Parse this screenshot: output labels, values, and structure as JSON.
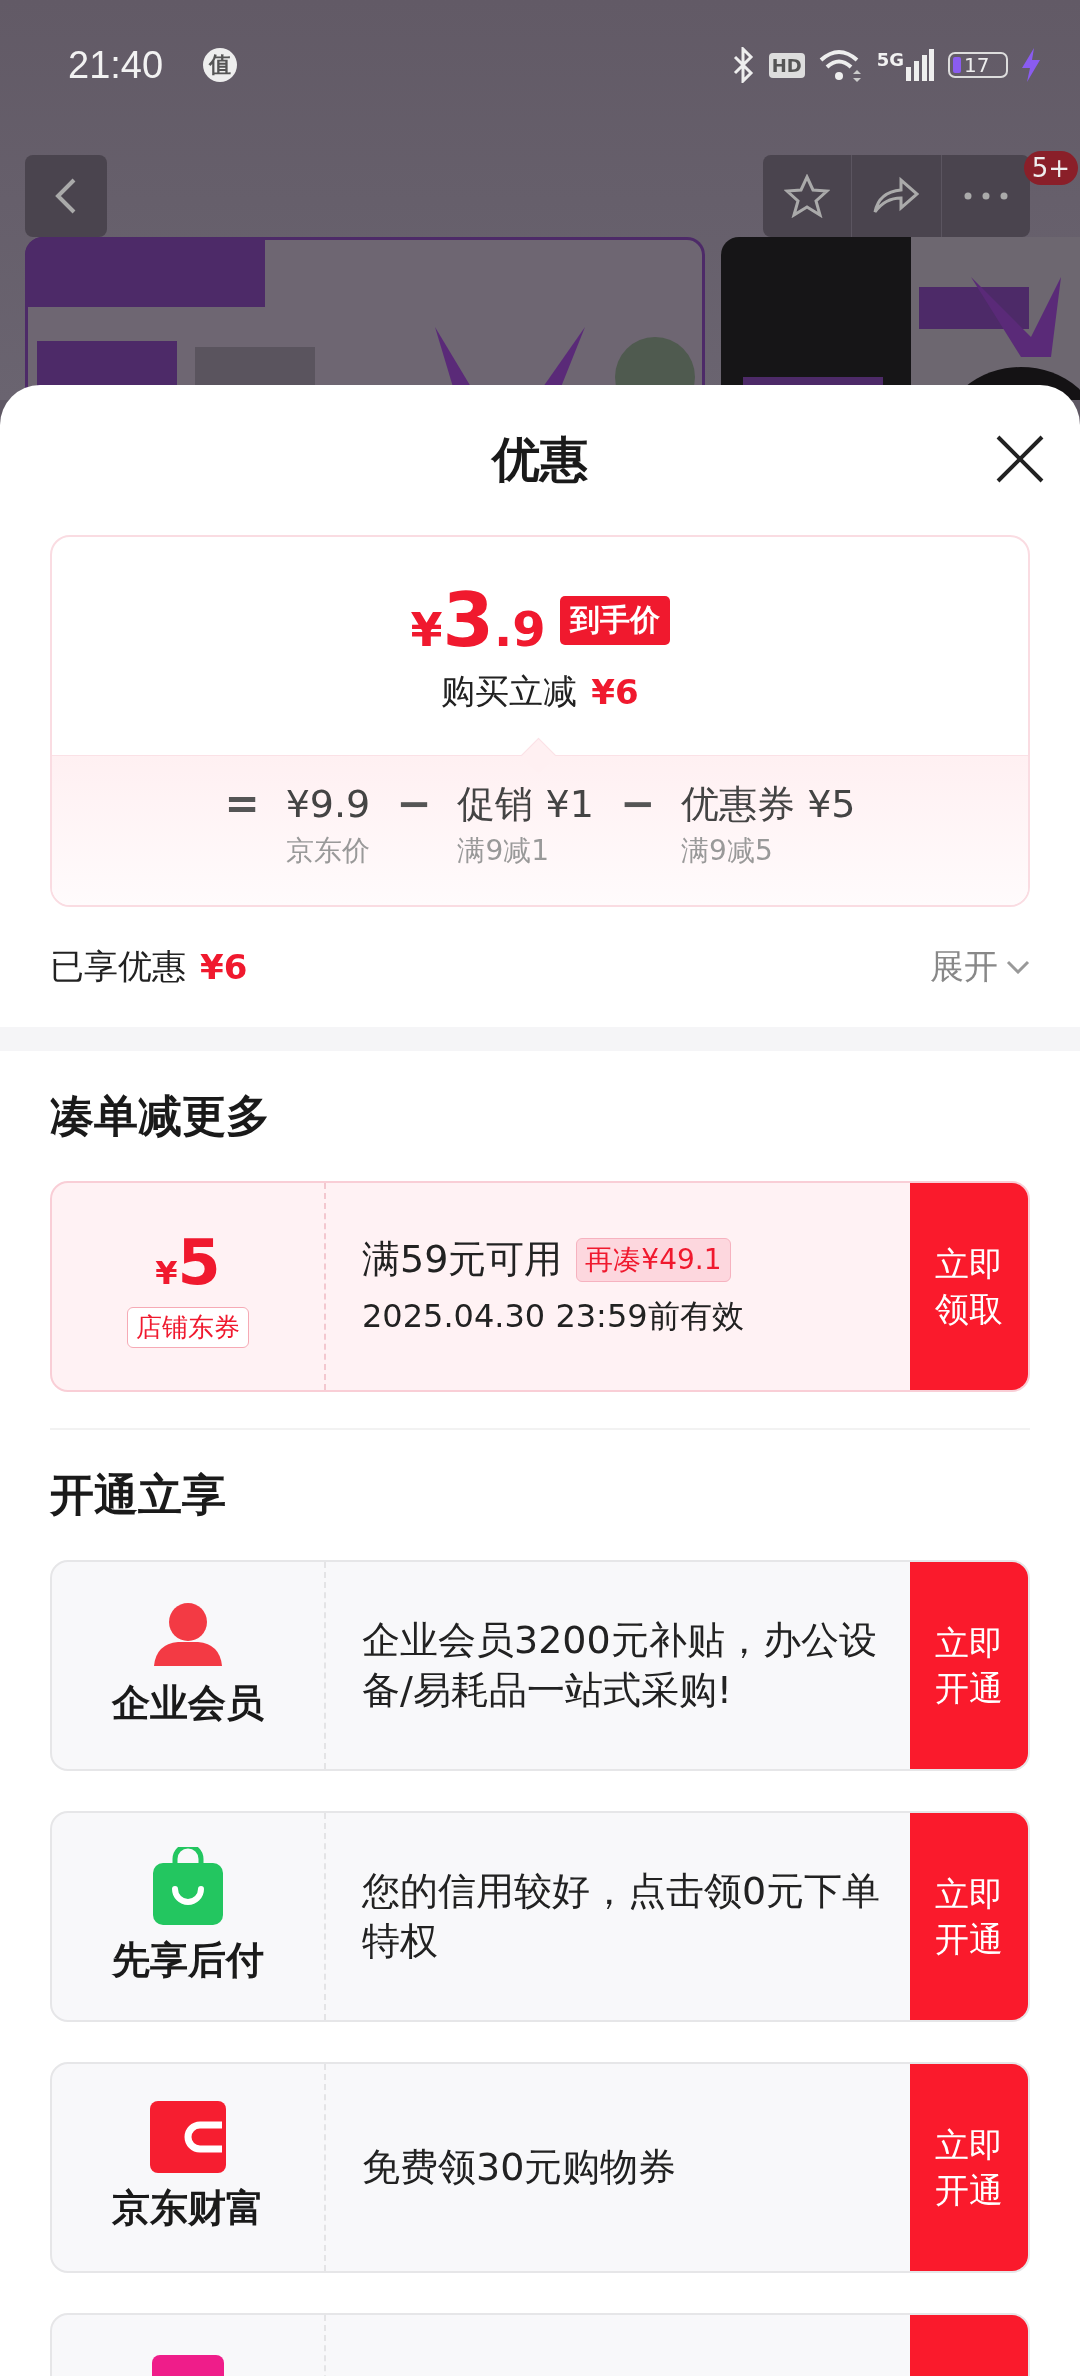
{
  "status_bar": {
    "time": "21:40",
    "app_badge": "值",
    "hd": "HD",
    "network": "5G",
    "battery": "17"
  },
  "nav": {
    "notification_badge": "5+"
  },
  "sheet": {
    "title": "优惠",
    "price": {
      "currency": "¥",
      "integer": "3",
      "decimal": ".9",
      "tag": "到手价",
      "saving_label": "购买立减",
      "saving": "¥6"
    },
    "breakdown": [
      {
        "op": "=",
        "value": "¥9.9",
        "note": "京东价"
      },
      {
        "op": "−",
        "value": "促销 ¥1",
        "note": "满9减1"
      },
      {
        "op": "−",
        "value": "优惠券 ¥5",
        "note": "满9减5"
      }
    ],
    "enjoyed_label": "已享优惠",
    "enjoyed": "¥6",
    "expand": "展开"
  },
  "bundle_section": {
    "title": "凑单减更多",
    "coupon": {
      "currency": "¥",
      "amount": "5",
      "type": "店铺东券",
      "condition": "满59元可用",
      "gap": "再凑¥49.1",
      "validity": "2025.04.30 23:59前有效",
      "button": "立即领取"
    }
  },
  "open_section": {
    "title": "开通立享",
    "offers": [
      {
        "kind": "member",
        "name": "企业会员",
        "desc": "企业会员3200元补贴，办公设备/易耗品一站式采购!",
        "button": "立即开通"
      },
      {
        "kind": "pay-later",
        "name": "先享后付",
        "desc": "您的信用较好，点击领0元下单特权",
        "button": "立即开通"
      },
      {
        "kind": "wealth",
        "name": "京东财富",
        "desc": "免费领30元购物券",
        "button": "立即开通"
      },
      {
        "kind": "other"
      }
    ]
  }
}
